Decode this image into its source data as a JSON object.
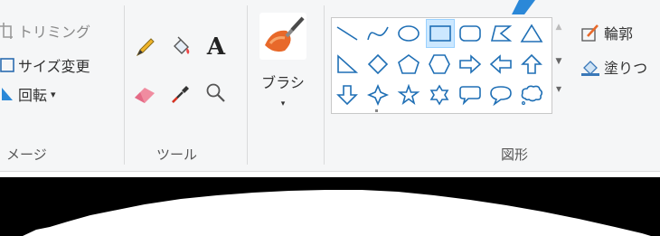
{
  "image_group": {
    "label": "メージ",
    "crop_label": "トリミング",
    "resize_label": "サイズ変更",
    "rotate_label": "回転",
    "rotate_dropdown": "▾"
  },
  "tools_group": {
    "label": "ツール",
    "tools": [
      "pencil-icon",
      "fill-bucket-icon",
      "text-icon",
      "eraser-icon",
      "color-picker-icon",
      "magnifier-icon"
    ],
    "text_tool_glyph": "A"
  },
  "brush": {
    "label": "ブラシ",
    "dropdown": "▾"
  },
  "shapes_group": {
    "label": "図形",
    "gallery": [
      [
        "line",
        "curve",
        "oval",
        "rectangle",
        "rounded-rectangle",
        "polygon",
        "triangle"
      ],
      [
        "right-triangle",
        "diamond",
        "pentagon",
        "hexagon",
        "right-arrow",
        "left-arrow",
        "up-arrow"
      ],
      [
        "down-arrow",
        "four-point-star",
        "five-point-star",
        "six-point-star",
        "rounded-callout",
        "oval-callout",
        "cloud-callout"
      ]
    ],
    "selected": "rectangle",
    "outline_label": "輪郭",
    "fill_label": "塗りつ",
    "scroll_up": "▲",
    "scroll_down": "▼",
    "scroll_more": "▾"
  },
  "colors": {
    "ribbon_bg": "#f5f6f7",
    "accent_blue": "#2b88d8",
    "selection_bg": "#cce8ff",
    "shape_stroke": "#1f6fb5",
    "canvas_black": "#000000"
  }
}
